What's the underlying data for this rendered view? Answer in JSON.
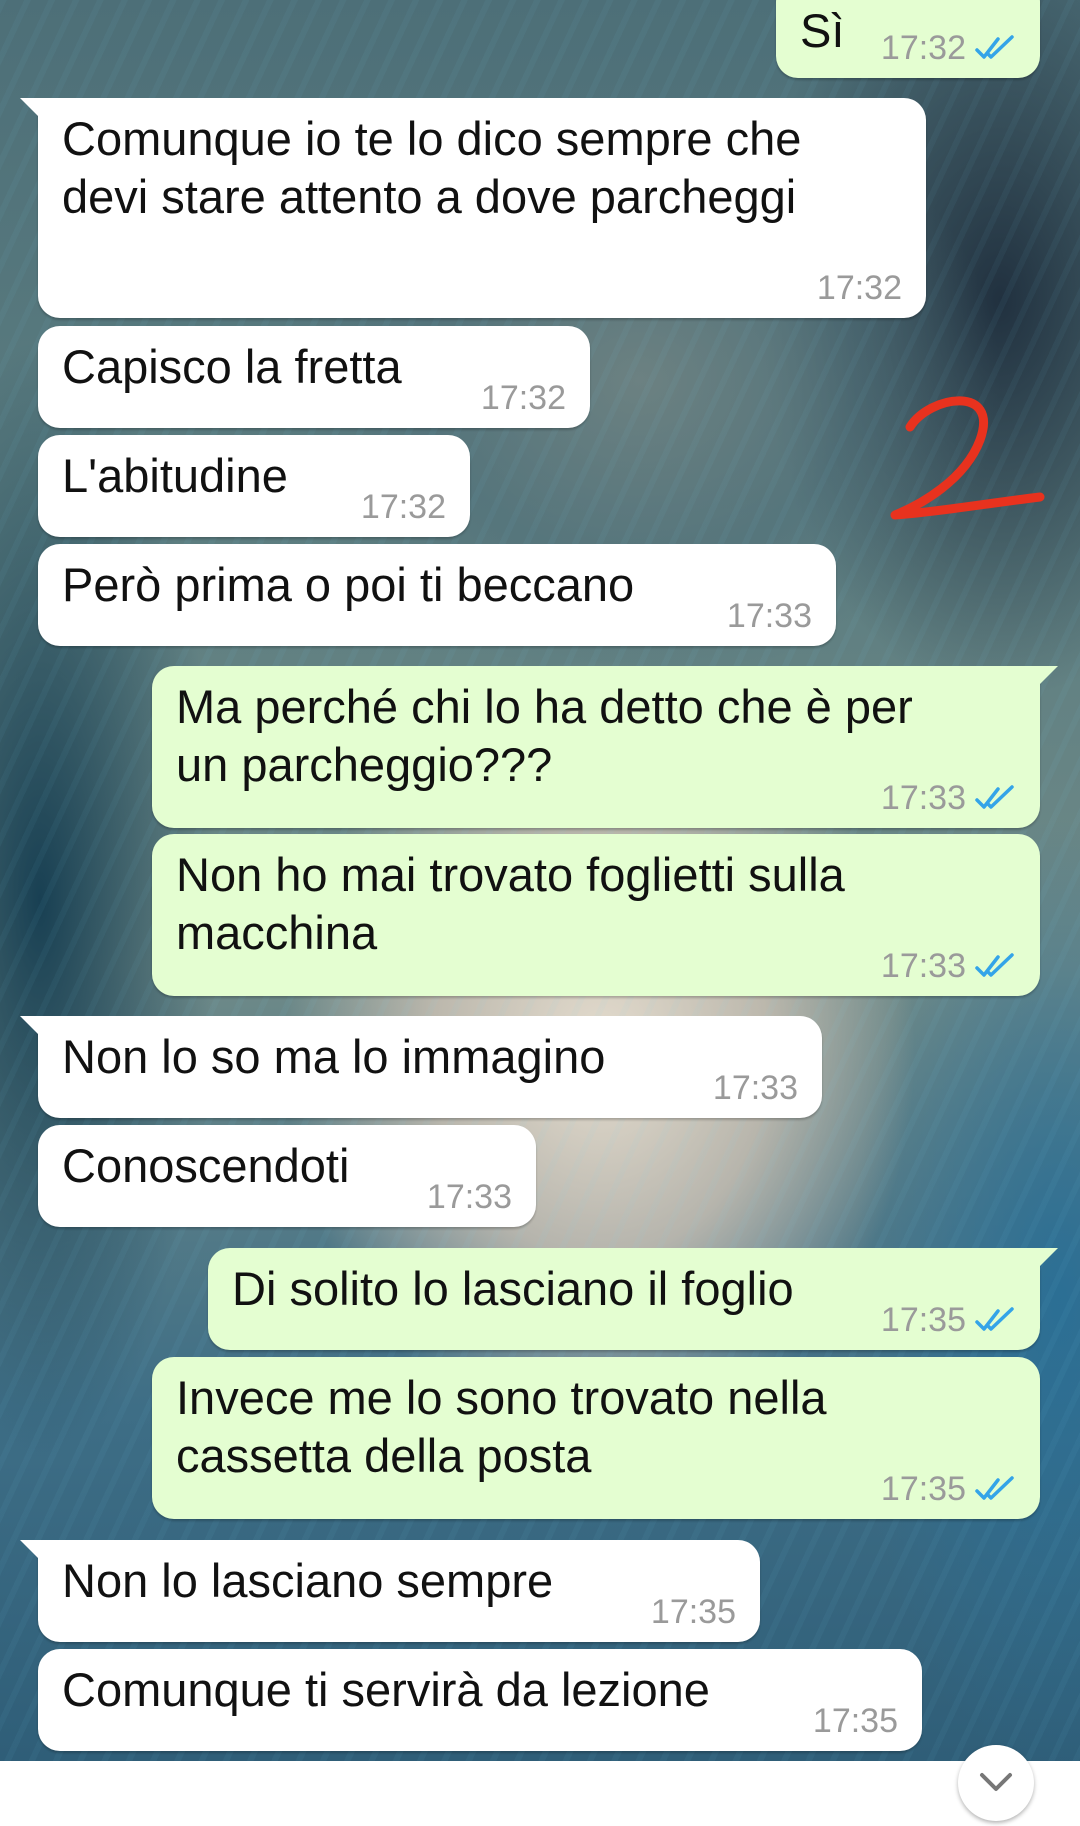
{
  "chat": {
    "messages": [
      {
        "direction": "out",
        "text": "Sì",
        "time": "17:32",
        "status": "read"
      },
      {
        "direction": "in",
        "text": "Comunque io te lo dico sempre che devi stare attento a dove parcheggi",
        "time": "17:32"
      },
      {
        "direction": "in",
        "text": "Capisco la fretta",
        "time": "17:32"
      },
      {
        "direction": "in",
        "text": "L'abitudine",
        "time": "17:32"
      },
      {
        "direction": "in",
        "text": "Però prima o poi ti beccano",
        "time": "17:33"
      },
      {
        "direction": "out",
        "text": "Ma perché chi lo ha detto che è per un parcheggio???",
        "time": "17:33",
        "status": "read"
      },
      {
        "direction": "out",
        "text": "Non ho mai trovato foglietti sulla macchina",
        "time": "17:33",
        "status": "read"
      },
      {
        "direction": "in",
        "text": "Non lo so ma lo immagino",
        "time": "17:33"
      },
      {
        "direction": "in",
        "text": "Conoscendoti",
        "time": "17:33"
      },
      {
        "direction": "out",
        "text": "Di solito lo lasciano il foglio",
        "time": "17:35",
        "status": "read"
      },
      {
        "direction": "out",
        "text": "Invece me lo sono trovato nella cassetta della posta",
        "time": "17:35",
        "status": "read"
      },
      {
        "direction": "in",
        "text": "Non lo lasciano sempre",
        "time": "17:35"
      },
      {
        "direction": "in",
        "text": "Comunque ti servirà da lezione",
        "time": "17:35"
      }
    ]
  },
  "annotation": {
    "text": "2",
    "color": "#e8321e"
  },
  "colors": {
    "incoming_bubble": "#ffffff",
    "outgoing_bubble": "#e4fed1",
    "timestamp": "#9a9a9a",
    "read_ticks": "#34a4e8"
  },
  "icons": {
    "read_status": "double-check-icon",
    "scroll_down": "chevron-down-icon"
  }
}
